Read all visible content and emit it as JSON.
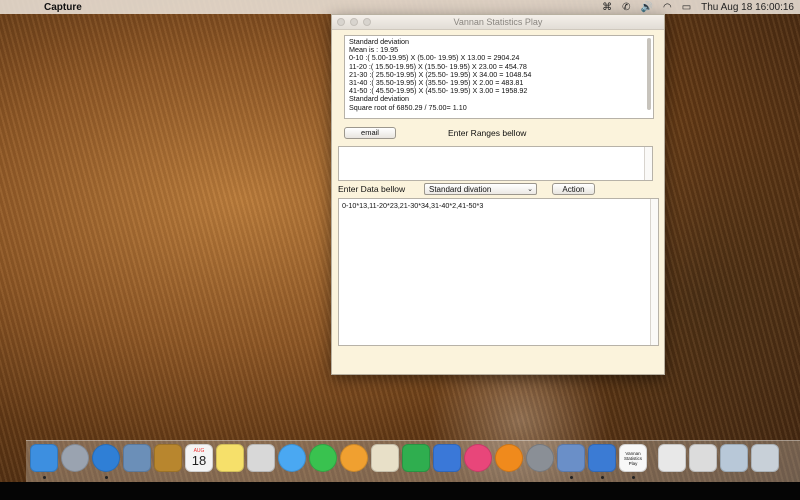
{
  "menubar": {
    "app_name": "Capture",
    "clock": "Thu Aug 18  16:00:16",
    "icons": [
      "apple-icon",
      "menu-extra-icon",
      "phone-icon",
      "volume-icon",
      "wifi-icon",
      "battery-icon",
      "search-icon",
      "list-icon"
    ]
  },
  "window": {
    "title": "Vannan Statistics Play",
    "output_lines": [
      "Standard deviation",
      "",
      "Mean is : 19.95",
      "0-10 :( 5.00-19.95) X (5.00- 19.95) X 13.00 = 2904.24",
      "11-20 :( 15.50-19.95) X (15.50- 19.95) X 23.00 = 454.78",
      "21-30 :( 25.50-19.95) X (25.50- 19.95) X 34.00 = 1048.54",
      "31-40 :( 35.50-19.95) X (35.50- 19.95) X 2.00 = 483.81",
      "41-50 :( 45.50-19.95) X (45.50- 19.95) X 3.00 = 1958.92",
      "Standard deviation",
      "Square root of 6850.29 / 75.00= 1.10"
    ],
    "email_label": "email",
    "ranges_label": "Enter Ranges bellow",
    "ranges_value": "",
    "data_label": "Enter Data bellow",
    "select_value": "Standard divation",
    "action_label": "Action",
    "data_value": "0-10*13,11-20*23,21-30*34,31-40*2,41-50*3"
  },
  "dock": {
    "items": [
      {
        "name": "finder",
        "color": "#3d8fe0"
      },
      {
        "name": "launchpad",
        "color": "#9aa3b0"
      },
      {
        "name": "safari",
        "color": "#2f7fd6"
      },
      {
        "name": "preview",
        "color": "#6b8fb8"
      },
      {
        "name": "notes-book",
        "color": "#b8862e"
      },
      {
        "name": "calendar",
        "color": "#f4f4f4"
      },
      {
        "name": "notes",
        "color": "#f6e06a"
      },
      {
        "name": "photos-viewer",
        "color": "#d8d8d8"
      },
      {
        "name": "messages",
        "color": "#4aa8f2"
      },
      {
        "name": "facetime",
        "color": "#39c24f"
      },
      {
        "name": "photos",
        "color": "#f0a030"
      },
      {
        "name": "textedit",
        "color": "#e8e0c8"
      },
      {
        "name": "numbers",
        "color": "#2fae4f"
      },
      {
        "name": "keynote",
        "color": "#3a78d8"
      },
      {
        "name": "itunes",
        "color": "#e8467a"
      },
      {
        "name": "ibooks",
        "color": "#f08a1c"
      },
      {
        "name": "system-preferences",
        "color": "#8a8f96"
      },
      {
        "name": "virtualbox",
        "color": "#6a8fc8"
      },
      {
        "name": "xcode",
        "color": "#3b7bd4"
      },
      {
        "name": "vannan-statistics-play",
        "color": "#f8f8f8"
      },
      {
        "name": "document",
        "color": "#e8e8e8"
      },
      {
        "name": "utility",
        "color": "#dcdcdc"
      },
      {
        "name": "downloads",
        "color": "#b8c8d8"
      },
      {
        "name": "trash",
        "color": "#c8d0d8"
      }
    ],
    "calendar_day": "18",
    "calendar_month": "AUG",
    "vannan_icon_text": "Vannan Statistics Play"
  }
}
